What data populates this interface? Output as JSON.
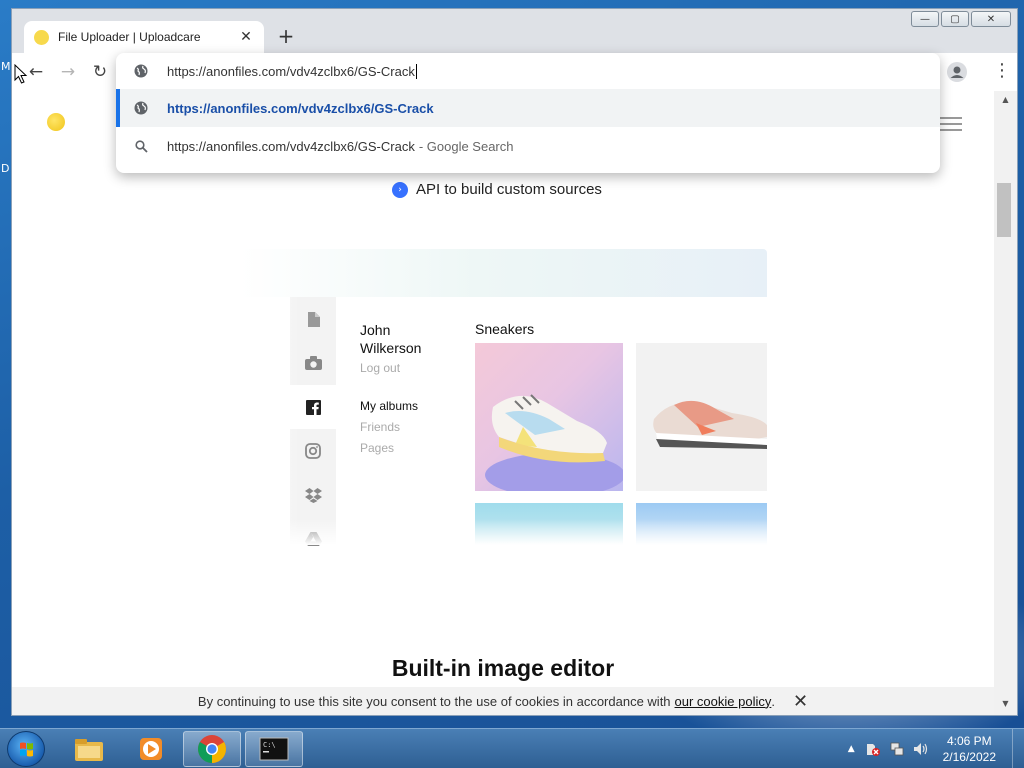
{
  "desktop": {
    "letters": [
      "M",
      "D"
    ]
  },
  "browser": {
    "tab": {
      "title": "File Uploader | Uploadcare",
      "close_glyph": "✕"
    },
    "new_tab_glyph": "+",
    "window_controls": {
      "minimize": "—",
      "maximize": "▢",
      "close": "✕"
    },
    "nav": {
      "back": "←",
      "forward": "→",
      "reload": "↻",
      "menu": "⋮"
    }
  },
  "omnibox": {
    "input_value": "https://anonfiles.com/vdv4zclbx6/GS-Crack",
    "suggestions": [
      {
        "text": "https://anonfiles.com/vdv4zclbx6/GS-Crack",
        "suffix": "",
        "icon": "globe-icon",
        "selected": true
      },
      {
        "text": "https://anonfiles.com/vdv4zclbx6/GS-Crack",
        "suffix": " - Google Search",
        "icon": "search-icon",
        "selected": false
      }
    ]
  },
  "page": {
    "api_text": "API to build custom sources",
    "demo": {
      "user_name": "John Wilkerson",
      "logout": "Log out",
      "albums": "My albums",
      "friends": "Friends",
      "pages": "Pages",
      "gallery_title": "Sneakers",
      "rail_icons": [
        "file-icon",
        "camera-icon",
        "facebook-icon",
        "instagram-icon",
        "dropbox-icon",
        "google-drive-icon"
      ]
    },
    "editor_heading": "Built-in image editor",
    "cookie": {
      "text": "By continuing to use this site you consent to the use of cookies in accordance with",
      "link": "our cookie policy",
      "period": ".",
      "close": "✕"
    }
  },
  "taskbar": {
    "time": "4:06 PM",
    "date": "2/16/2022",
    "items": [
      "explorer-icon",
      "media-player-icon",
      "chrome-icon",
      "cmd-icon"
    ]
  },
  "colors": {
    "accent": "#1a73e8",
    "brand_yellow": "#f7d94c",
    "taskbar": "#2e5f93"
  }
}
